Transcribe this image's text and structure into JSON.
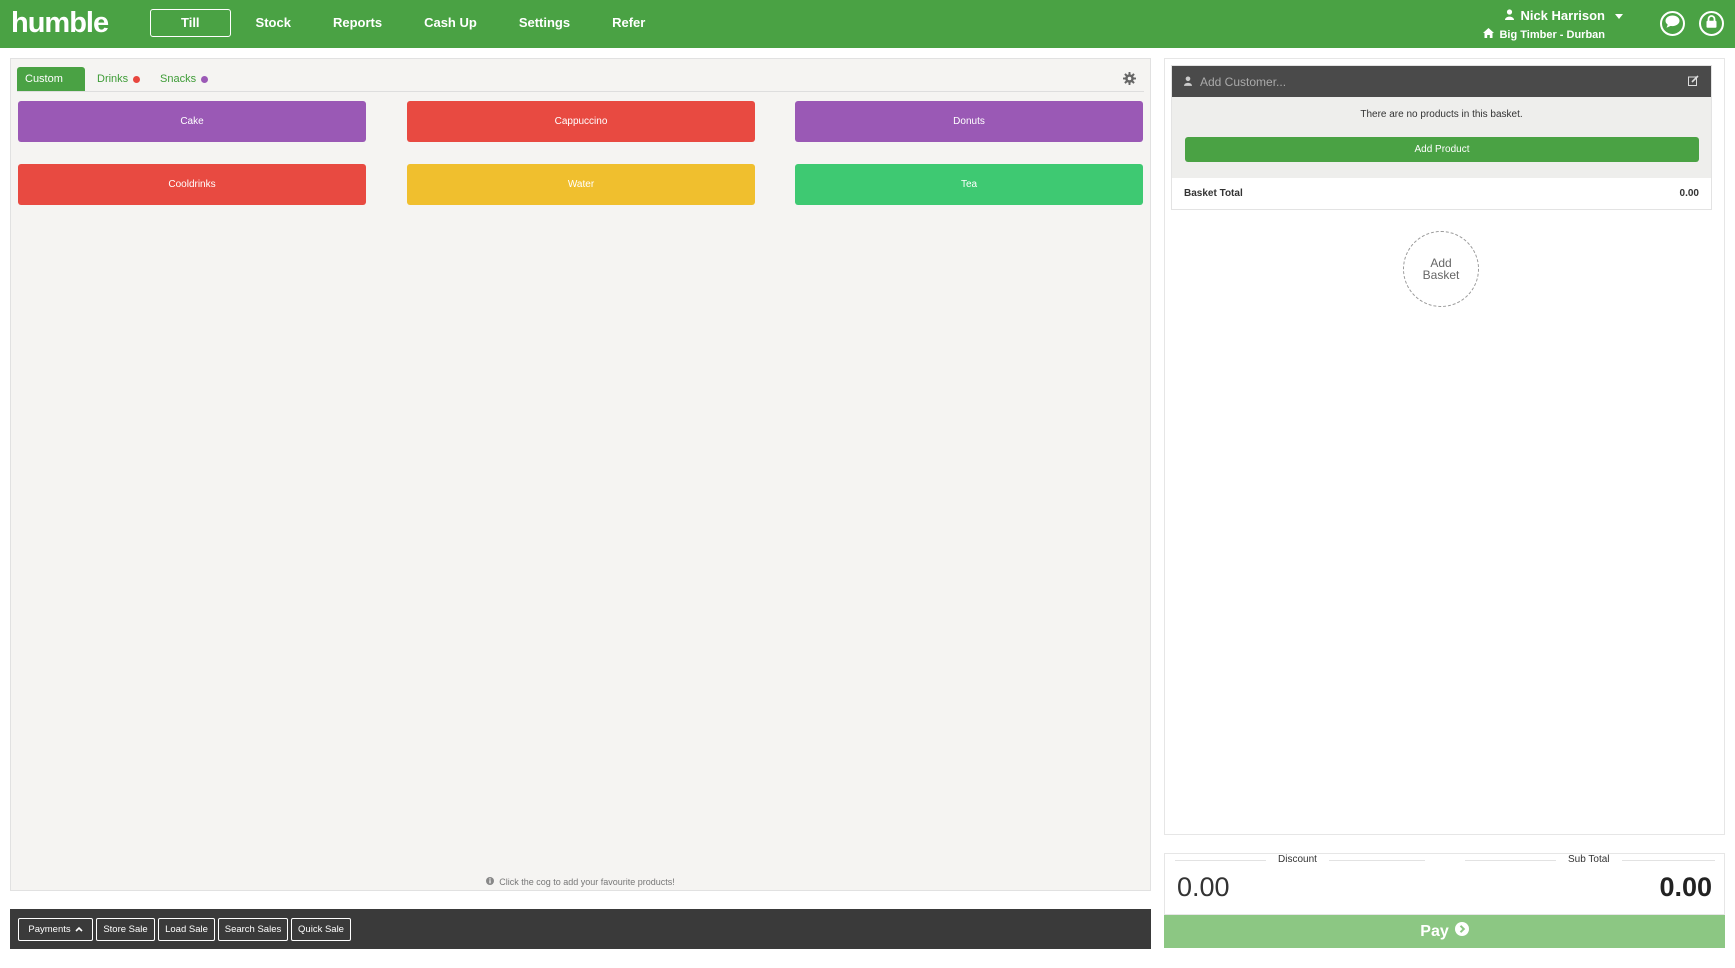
{
  "app": {
    "logo": "humble",
    "brand_color": "#4aa244"
  },
  "nav": {
    "items": [
      {
        "label": "Till",
        "active": true
      },
      {
        "label": "Stock"
      },
      {
        "label": "Reports"
      },
      {
        "label": "Cash Up"
      },
      {
        "label": "Settings"
      },
      {
        "label": "Refer"
      }
    ]
  },
  "user": {
    "name": "Nick Harrison",
    "location": "Big Timber - Durban",
    "icon": "user-icon",
    "location_icon": "home-icon"
  },
  "header_buttons": {
    "chat": "chat-icon",
    "lock": "lock-icon"
  },
  "tabs": [
    {
      "label": "Custom",
      "active": true
    },
    {
      "label": "Drinks",
      "dot_color": "#e8463e"
    },
    {
      "label": "Snacks",
      "dot_color": "#9b59b6"
    }
  ],
  "products": [
    {
      "label": "Cake",
      "color": "#9a59b5"
    },
    {
      "label": "Cappuccino",
      "color": "#e84a41"
    },
    {
      "label": "Donuts",
      "color": "#9a59b5"
    },
    {
      "label": "Cooldrinks",
      "color": "#e84a41"
    },
    {
      "label": "Water",
      "color": "#f0bf2e"
    },
    {
      "label": "Tea",
      "color": "#3ec972"
    }
  ],
  "hint": "Click the cog to add your favourite products!",
  "bottom_bar": {
    "payments": "Payments",
    "store_sale": "Store Sale",
    "load_sale": "Load Sale",
    "search_sales": "Search Sales",
    "quick_sale": "Quick Sale"
  },
  "basket": {
    "customer_placeholder": "Add Customer...",
    "empty_message": "There are no products in this basket.",
    "add_product": "Add Product",
    "total_label": "Basket Total",
    "total_value": "0.00",
    "add_basket_line1": "Add",
    "add_basket_line2": "Basket"
  },
  "totals": {
    "discount_label": "Discount",
    "discount_value": "0.00",
    "subtotal_label": "Sub Total",
    "subtotal_value": "0.00"
  },
  "pay": {
    "label": "Pay",
    "color": "#8cc783"
  }
}
